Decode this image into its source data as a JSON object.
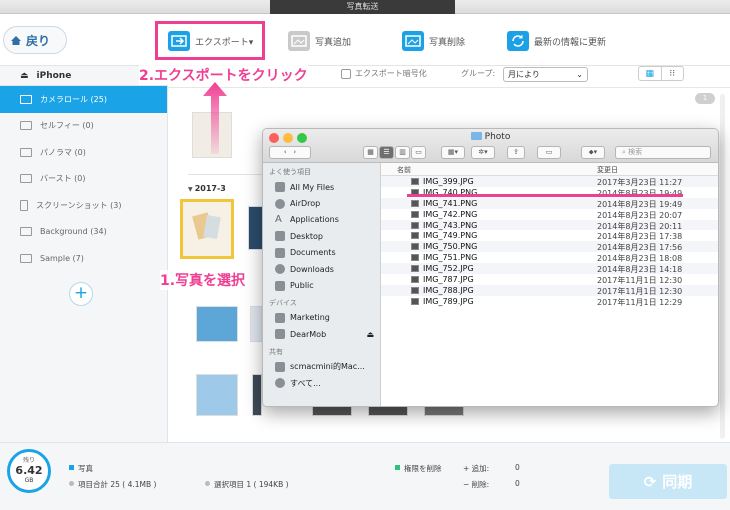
{
  "window": {
    "title": "写真転送"
  },
  "toolbar": {
    "back_label": "戻り",
    "items": [
      {
        "label": "エクスポート▾"
      },
      {
        "label": "写真追加"
      },
      {
        "label": "写真削除"
      },
      {
        "label": "最新の情報に更新"
      }
    ]
  },
  "sidebar": {
    "device": "iPhone",
    "items": [
      {
        "label": "カメラロール (25)",
        "icon": "camera-icon"
      },
      {
        "label": "セルフィー (0)",
        "icon": "selfie-icon"
      },
      {
        "label": "パノラマ (0)",
        "icon": "panorama-icon"
      },
      {
        "label": "バースト (0)",
        "icon": "burst-icon"
      },
      {
        "label": "スクリーンショット (3)",
        "icon": "screenshot-icon"
      },
      {
        "label": "Background (34)",
        "icon": "album-icon"
      },
      {
        "label": "Sample (7)",
        "icon": "album-icon"
      }
    ],
    "add_label": "+"
  },
  "subbar": {
    "export_encrypt_label": "エクスポート暗号化",
    "group_label": "グループ:",
    "group_value": "月により"
  },
  "main": {
    "count_badge": "1",
    "date_groups": [
      "2017-3"
    ]
  },
  "callouts": {
    "step2": "2.エクスポートをクリック",
    "step1": "1.写真を選択"
  },
  "finder": {
    "title": "Photo",
    "search_placeholder": "検索",
    "favorites_header": "よく使う項目",
    "favorites": [
      "All My Files",
      "AirDrop",
      "Applications",
      "Desktop",
      "Documents",
      "Downloads",
      "Public"
    ],
    "devices_header": "デバイス",
    "devices": [
      "Marketing",
      "DearMob"
    ],
    "shared_header": "共有",
    "shared": [
      "scmacmini的Mac...",
      "すべて..."
    ],
    "col_name": "名前",
    "col_date": "変更日",
    "files": [
      {
        "name": "IMG_399.JPG",
        "date": "2017年3月23日 11:27"
      },
      {
        "name": "IMG_740.PNG",
        "date": "2014年8月23日 19:49"
      },
      {
        "name": "IMG_741.PNG",
        "date": "2014年8月23日 19:49"
      },
      {
        "name": "IMG_742.PNG",
        "date": "2014年8月23日 20:07"
      },
      {
        "name": "IMG_743.PNG",
        "date": "2014年8月23日 20:11"
      },
      {
        "name": "IMG_749.PNG",
        "date": "2014年8月23日 17:38"
      },
      {
        "name": "IMG_750.PNG",
        "date": "2014年8月23日 17:56"
      },
      {
        "name": "IMG_751.PNG",
        "date": "2014年8月23日 18:08"
      },
      {
        "name": "IMG_752.JPG",
        "date": "2014年8月23日 14:18"
      },
      {
        "name": "IMG_787.JPG",
        "date": "2017年11月1日 12:30"
      },
      {
        "name": "IMG_788.JPG",
        "date": "2017年11月1日 12:30"
      },
      {
        "name": "IMG_789.JPG",
        "date": "2017年11月1日 12:29"
      }
    ]
  },
  "bottom": {
    "gauge_top": "残り",
    "gauge_value": "6.42",
    "gauge_unit": "GB",
    "legend_photo": "写真",
    "total_items": "項目合計 25 ( 4.1MB )",
    "selected_items": "選択項目 1 ( 194KB )",
    "pending_delete": "権限を削除",
    "add_label": "+  追加:",
    "add_value": "0",
    "del_label": "−  削除:",
    "del_value": "0",
    "sync_label": "同期"
  },
  "colors": {
    "accent": "#1aa3e6",
    "highlight": "#ef3f93"
  }
}
